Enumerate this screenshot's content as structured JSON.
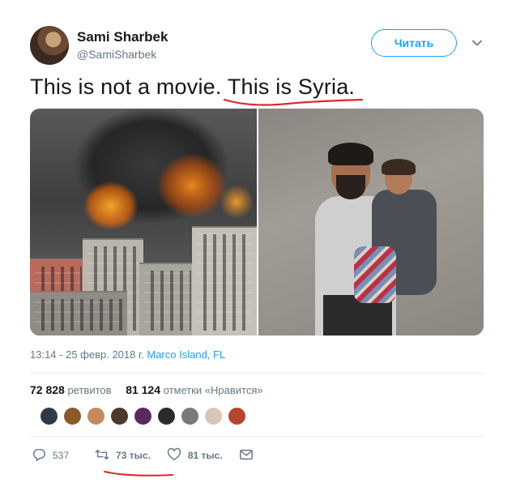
{
  "author": {
    "name": "Sami Sharbek",
    "handle": "@SamiSharbek"
  },
  "follow_button": "Читать",
  "tweet_text": "This is not a movie. This is Syria.",
  "meta": {
    "timestamp": "13:14 - 25 февр. 2018 г.",
    "location": "Marco Island, FL"
  },
  "stats": {
    "retweets_count": "72 828",
    "retweets_label": "ретвитов",
    "likes_count": "81 124",
    "likes_label": "отметки «Нравится»"
  },
  "actions": {
    "reply_count": "537",
    "retweet_count": "73 тыс.",
    "like_count": "81 тыс."
  },
  "icons": {
    "reply": "reply-icon",
    "retweet": "retweet-icon",
    "like": "heart-icon",
    "message": "envelope-icon",
    "menu": "chevron-down-icon"
  },
  "colors": {
    "accent": "#1da1f2",
    "annotation": "#e0262e",
    "muted": "#657786"
  }
}
